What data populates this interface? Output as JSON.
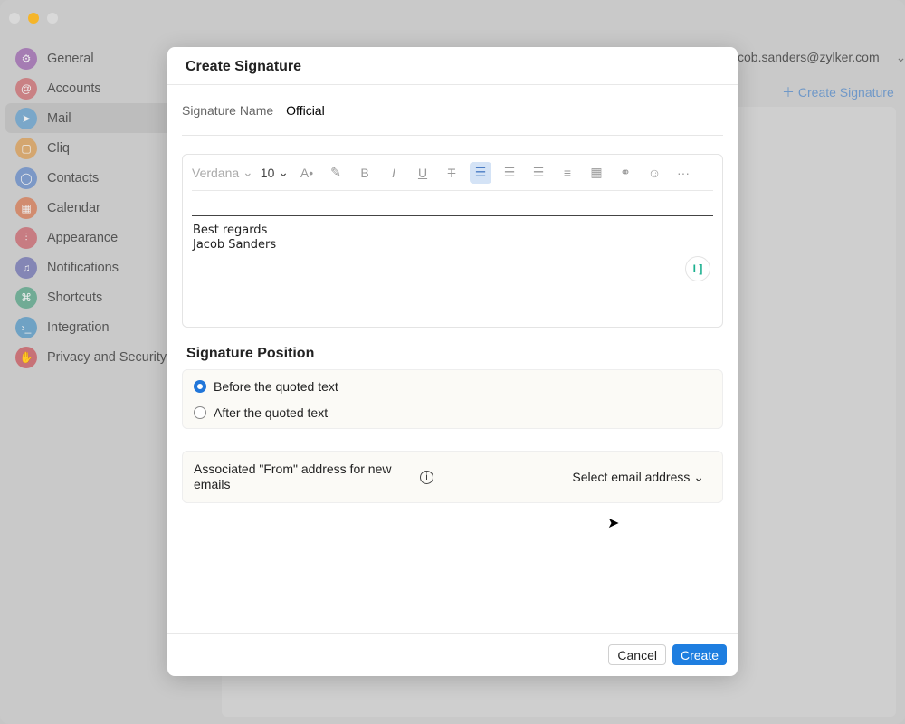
{
  "sidebar": {
    "items": [
      {
        "label": "General",
        "icon": "gear-icon",
        "color": "#a57cb3"
      },
      {
        "label": "Accounts",
        "icon": "at-icon",
        "color": "#c98184"
      },
      {
        "label": "Mail",
        "icon": "send-icon",
        "color": "#7aa7c9"
      },
      {
        "label": "Cliq",
        "icon": "chat-icon",
        "color": "#d4a66f"
      },
      {
        "label": "Contacts",
        "icon": "person-icon",
        "color": "#7c98c6"
      },
      {
        "label": "Calendar",
        "icon": "calendar-icon",
        "color": "#d18c6f"
      },
      {
        "label": "Appearance",
        "icon": "sliders-icon",
        "color": "#c77c82"
      },
      {
        "label": "Notifications",
        "icon": "bell-icon",
        "color": "#8486b5"
      },
      {
        "label": "Shortcuts",
        "icon": "command-icon",
        "color": "#71ab95"
      },
      {
        "label": "Integration",
        "icon": "terminal-icon",
        "color": "#6fa2c4"
      },
      {
        "label": "Privacy and Security",
        "icon": "hand-icon",
        "color": "#c77277"
      }
    ]
  },
  "header": {
    "account": "cob.sanders@zylker.com",
    "create_signature": "Create Signature"
  },
  "modal": {
    "title": "Create Signature",
    "name_label": "Signature Name",
    "name_value": "Official",
    "toolbar": {
      "font": "Verdana",
      "size": "10"
    },
    "signature_lines": [
      "Best regards",
      "Jacob Sanders"
    ],
    "position_title": "Signature Position",
    "positions": [
      "Before the quoted text",
      "After the quoted text"
    ],
    "selected_position": 0,
    "from_label": "Associated \"From\" address for new emails",
    "from_select": "Select email address",
    "cancel": "Cancel",
    "create": "Create"
  }
}
